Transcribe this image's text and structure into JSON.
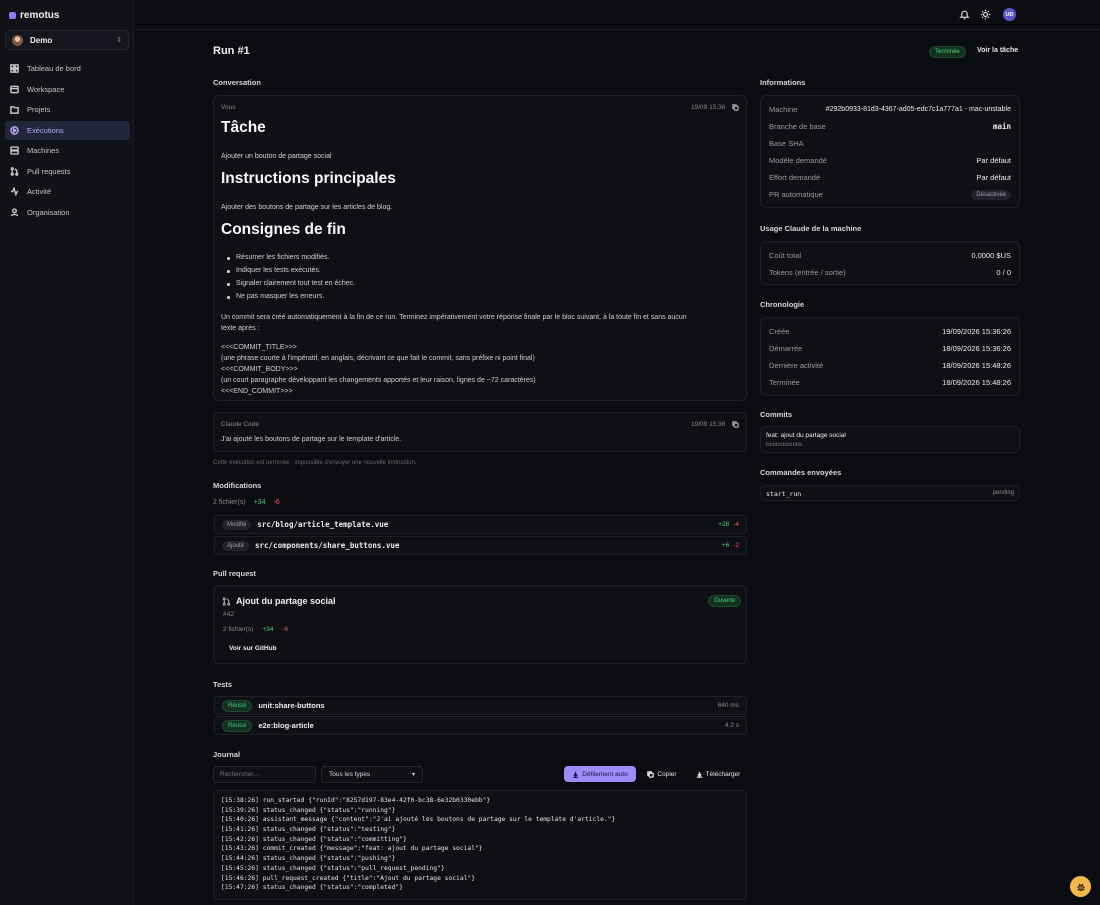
{
  "app": {
    "name": "remotus",
    "org": "Demo",
    "user_initials": "UD"
  },
  "nav": [
    {
      "label": "Tableau de bord",
      "icon": "dashboard-icon"
    },
    {
      "label": "Workspace",
      "icon": "workspace-icon"
    },
    {
      "label": "Projets",
      "icon": "folder-icon"
    },
    {
      "label": "Exécutions",
      "icon": "play-icon",
      "active": true
    },
    {
      "label": "Machines",
      "icon": "server-icon"
    },
    {
      "label": "Pull requests",
      "icon": "pull-request-icon"
    },
    {
      "label": "Activité",
      "icon": "activity-icon"
    },
    {
      "label": "Organisation",
      "icon": "people-icon"
    }
  ],
  "header": {
    "title": "Run #1",
    "status": "Terminée",
    "view_task": "Voir la tâche"
  },
  "conversation": {
    "title": "Conversation",
    "user_msg": {
      "author": "Vous",
      "time": "19/09 15:36",
      "h_task": "Tâche",
      "task": "Ajouter un bouton de partage social",
      "h_main": "Instructions principales",
      "main": "Ajouter des boutons de partage sur les articles de blog.",
      "h_end": "Consignes de fin",
      "bullets": [
        "Résumer les fichiers modifiés.",
        "Indiquer les tests exécutés.",
        "Signaler clairement tout test en échec.",
        "Ne pas masquer les erreurs."
      ],
      "commit_p1": "Un commit sera créé automatiquement à la fin de ce run. Terminez impérativement votre réponse finale par le bloc suivant, à la toute fin et sans aucun",
      "commit_p2": "texte après :",
      "block": [
        "<<<COMMIT_TITLE>>>",
        "(une phrase courte à l'impératif, en anglais, décrivant ce que fait le commit, sans préfixe ni point final)",
        "<<<COMMIT_BODY>>>",
        "(un court paragraphe développant les changements apportés et leur raison, lignes de ~72 caractères)",
        "<<<END_COMMIT>>>"
      ]
    },
    "bot_msg": {
      "author": "Claude Code",
      "time": "19/09 15:36",
      "text": "J'ai ajouté les boutons de partage sur le template d'article."
    },
    "closed_note": "Cette exécution est terminée : impossible d'envoyer une nouvelle instruction."
  },
  "modifications": {
    "title": "Modifications",
    "summary": "2 fichier(s)",
    "add": "+34",
    "del": "-6",
    "files": [
      {
        "badge": "Modifié",
        "path": "src/blog/article_template.vue",
        "add": "+28",
        "del": "-4"
      },
      {
        "badge": "Ajouté",
        "path": "src/components/share_buttons.vue",
        "add": "+6",
        "del": "-2"
      }
    ]
  },
  "pull_request": {
    "title": "Pull request",
    "pr_title": "Ajout du partage social",
    "number": "#42",
    "status": "Ouverte",
    "files": "2 fichier(s)",
    "add": "+34",
    "del": "-6",
    "button": "Voir sur GitHub"
  },
  "tests": {
    "title": "Tests",
    "items": [
      {
        "badge": "Réussi",
        "name": "unit:share-buttons",
        "time": "640 ms"
      },
      {
        "badge": "Réussi",
        "name": "e2e:blog-article",
        "time": "4.2 s"
      }
    ]
  },
  "journal": {
    "title": "Journal",
    "search_placeholder": "Rechercher...",
    "filter": "Tous les types",
    "auto_scroll": "Défilement auto",
    "copy": "Copier",
    "download": "Télécharger",
    "lines": [
      "[15:38:26] run_started {\"runId\":\"8257d197-83e4-42f0-bc38-6e32b0330ebb\"}",
      "[15:39:26] status_changed {\"status\":\"running\"}",
      "[15:40:26] assistant_message {\"content\":\"J'ai ajouté les boutons de partage sur le template d'article.\"}",
      "[15:41:26] status_changed {\"status\":\"testing\"}",
      "[15:42:26] status_changed {\"status\":\"committing\"}",
      "[15:43:26] commit_created {\"message\":\"feat: ajout du partage social\"}",
      "[15:44:26] status_changed {\"status\":\"pushing\"}",
      "[15:45:26] status_changed {\"status\":\"pull_request_pending\"}",
      "[15:46:26] pull_request_created {\"title\":\"Ajout du partage social\"}",
      "[15:47:26] status_changed {\"status\":\"completed\"}"
    ]
  },
  "informations": {
    "title": "Informations",
    "rows": [
      {
        "label": "Machine",
        "value": "#292b0933-81d3-4367-ad05-edc7c1a777a1 - mac-unstable"
      },
      {
        "label": "Branche de base",
        "value": "main"
      },
      {
        "label": "Base SHA",
        "value": ""
      },
      {
        "label": "Modèle demandé",
        "value": "Par défaut"
      },
      {
        "label": "Effort demandé",
        "value": "Par défaut"
      },
      {
        "label": "PR automatique",
        "value": "Désactivée"
      }
    ]
  },
  "usage": {
    "title": "Usage Claude de la machine",
    "rows": [
      {
        "label": "Coût total",
        "value": "0,0000 $US"
      },
      {
        "label": "Tokens (entrée / sortie)",
        "value": "0 / 0"
      }
    ]
  },
  "chronologie": {
    "title": "Chronologie",
    "rows": [
      {
        "label": "Créée",
        "value": "19/09/2026 15:36:26"
      },
      {
        "label": "Démarrée",
        "value": "18/09/2026 15:36:26"
      },
      {
        "label": "Dernière activité",
        "value": "18/09/2026 15:48:26"
      },
      {
        "label": "Terminée",
        "value": "18/09/2026 15:48:26"
      }
    ]
  },
  "commits": {
    "title": "Commits",
    "message": "feat: ajout du partage social",
    "sha": "bbbbbbbbbbb"
  },
  "commands": {
    "title": "Commandes envoyées",
    "name": "start_run",
    "status": "pending"
  }
}
